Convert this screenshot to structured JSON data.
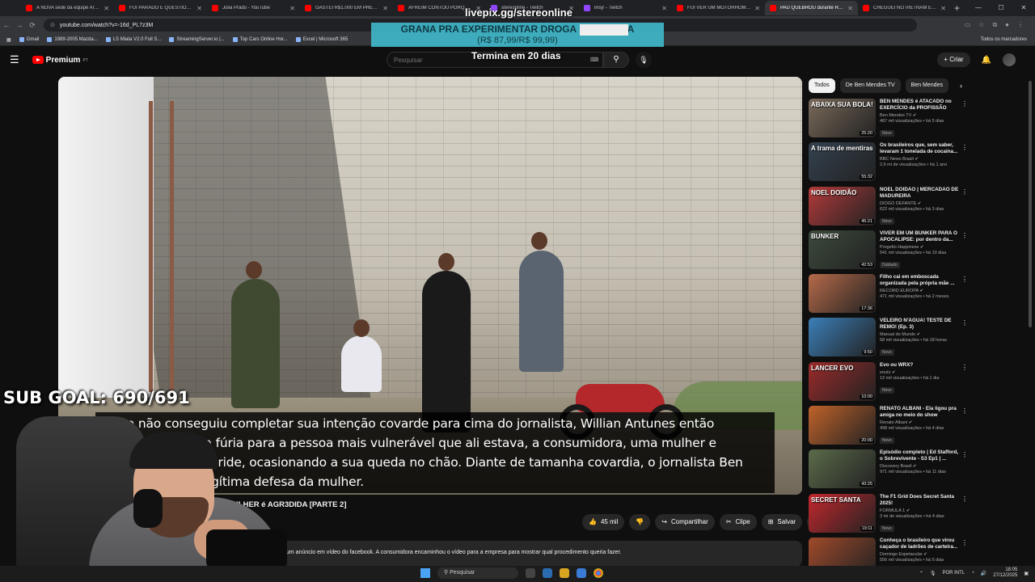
{
  "tabs": [
    {
      "title": "A NOVA sede da equipe Arro...",
      "fav": "youtube"
    },
    {
      "title": "FUI PARADO E QUESTIONADO...",
      "fav": "youtube"
    },
    {
      "title": "Julia Prado - YouTube",
      "fav": "youtube"
    },
    {
      "title": "GASTEI R$1.000 EM PRESENTE...",
      "fav": "youtube"
    },
    {
      "title": "AFREIM CONTOU PORQUE F...",
      "fav": "youtube"
    },
    {
      "title": "stereonline - Twitch",
      "fav": "twitch"
    },
    {
      "title": "linsjr - Twitch",
      "fav": "twitch"
    },
    {
      "title": "FUI VER UM MOTORHOME D...",
      "fav": "youtube"
    },
    {
      "title": "PAU QUEBROU durante REPOR...",
      "fav": "youtube"
    },
    {
      "title": "CHEGUEI NO VIETNAM E JÁ...",
      "fav": "youtube"
    }
  ],
  "url": "youtube.com/watch?v=-16d_PL7z3M",
  "bookmarks": [
    "Gmail",
    "1989-2005 Mazda...",
    "LS Miata V2.0 Full S...",
    "StreamingServer.io |...",
    "Top Cars Online Hor...",
    "Excel | Microsoft 365"
  ],
  "bookmarks_all": "Todos os marcadores",
  "overlay": {
    "livepix": "livepix.gg/stereonline",
    "promo_line1": "GRANA PRA EXPERIMENTAR DROGA NA GRINGA",
    "promo_line2": "(R$ 87,99/R$ 99,99)",
    "countdown": "Termina em 20 dias",
    "sub_goal": "SUB GOAL: 690/691"
  },
  "header": {
    "logo": "Premium",
    "logo_country": "PT",
    "search_placeholder": "Pesquisar",
    "create_label": "Criar"
  },
  "video": {
    "subtitle": "Como não conseguiu completar sua intenção covarde para cima do jornalista, Willian Antunes então direciona toda sua fúria para a pessoa mais vulnerável que ali estava, a consumidora, uma mulher e covardemente a agride, ocasionando a sua queda no chão. Diante de tamanha covardia, o jornalista Ben Mendes age em legítima defesa da mulher.",
    "title": "...ULHER é AGR3DIDA [PARTE 2]",
    "likes": "45 mil",
    "share": "Compartilhar",
    "clip": "Clipe",
    "save": "Salvar",
    "description": "um anúncio em vídeo do facebook. A consumidora encaminhou o vídeo para a empresa para mostrar qual procedimento queria fazer."
  },
  "chips": [
    "Todos",
    "De Ben Mendes TV",
    "Ben Mendes"
  ],
  "recommendations": [
    {
      "title": "BEN MENDES é ATACADO no EXERCÍCIO da PROFISSÃO",
      "channel": "Ben Mendes TV",
      "views": "487 mil visualizações • há 5 dias",
      "badge": "Novo",
      "duration": "25:20",
      "thumb_text": "ABAIXA SUA BOLA!",
      "color": "#7a6a5a"
    },
    {
      "title": "Os brasileiros que, sem saber, levaram 1 tonelada de cocaína...",
      "channel": "BBC News Brasil",
      "views": "2,6 mi de visualizações • há 1 ano",
      "badge": "",
      "duration": "55:32",
      "thumb_text": "A trama de mentiras",
      "color": "#33414e"
    },
    {
      "title": "NOEL DOIDÃO | MERCADÃO DE MADUREIRA",
      "channel": "DIOGO DEFANTE",
      "views": "622 mil visualizações • há 3 dias",
      "badge": "Novo",
      "duration": "45:21",
      "thumb_text": "NOEL DOIDÃO",
      "color": "#b33a3a"
    },
    {
      "title": "VIVER EM UM BUNKER PARA O APOCALIPSE: por dentro da...",
      "channel": "Progetto Happiness",
      "views": "541 mil visualizações • há 10 dias",
      "badge": "Dublado",
      "duration": "42:53",
      "thumb_text": "BUNKER",
      "color": "#3c4a3c"
    },
    {
      "title": "Filho cai em emboscada organizada pela própria mãe ...",
      "channel": "RECORD EUROPA",
      "views": "471 mil visualizações • há 2 meses",
      "badge": "",
      "duration": "17:36",
      "thumb_text": "",
      "color": "#b56a4a"
    },
    {
      "title": "VELEIRO N'ÁGUA! TESTE DE REMO! (Ep. 3)",
      "channel": "Manual do Mundo",
      "views": "58 mil visualizações • há 18 horas",
      "badge": "Novo",
      "duration": "9:50",
      "thumb_text": "",
      "color": "#3b7fb8"
    },
    {
      "title": "Evo ou WRX?",
      "channel": "eoutz",
      "views": "13 mil visualizações • há 1 dia",
      "badge": "Novo",
      "duration": "10:00",
      "thumb_text": "LANCER EVO",
      "color": "#9a2a2a"
    },
    {
      "title": "RENATO ALBANI - Ela ligou pra amiga no meio do show",
      "channel": "Renato Albani",
      "views": "498 mil visualizações • há 4 dias",
      "badge": "Novo",
      "duration": "20:00",
      "thumb_text": "",
      "color": "#c0622a"
    },
    {
      "title": "Episódio completo | Ed Stafford, o Sobrevivente - S3 Ep1 | ...",
      "channel": "Discovery Brasil",
      "views": "971 mil visualizações • há 11 dias",
      "badge": "",
      "duration": "43:25",
      "thumb_text": "",
      "color": "#5b6b4a"
    },
    {
      "title": "The F1 Grid Does Secret Santa 2025!",
      "channel": "FORMULA 1",
      "views": "3 mi de visualizações • há 4 dias",
      "badge": "Novo",
      "duration": "19:11",
      "thumb_text": "SECRET SANTA",
      "color": "#c2272d"
    },
    {
      "title": "Conheça o brasileiro que virou caçador de ladrões de carteira...",
      "channel": "Domingo Espetacular",
      "views": "556 mil visualizações • há 5 dias",
      "badge": "",
      "duration": "",
      "thumb_text": "",
      "color": "#a04a2a"
    }
  ],
  "taskbar": {
    "search": "Pesquisar",
    "lang": "POR INTL",
    "time": "18:05",
    "date": "27/12/2025"
  }
}
